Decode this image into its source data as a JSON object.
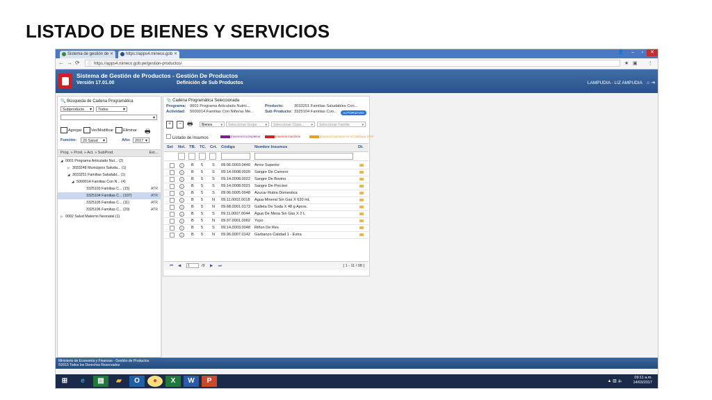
{
  "slide_title": "LISTADO DE BIENES Y SERVICIOS",
  "browser": {
    "tabs": [
      "Sistema de gestión de",
      "https://apps4.mineco.gob"
    ],
    "url": "https://apps4.mineco.gob.pe/gestion-productos/"
  },
  "app": {
    "system_name": "Sistema de Gestión de Productos - Gestión De Productos",
    "version": "Versión 17.01.00",
    "subtitle": "Definición de Sub Productos",
    "user": "LAMPUDIA - LIZ AMPUDIA"
  },
  "left": {
    "search_title": "Búsqueda de Cadena Programática",
    "select1": "Subproducto",
    "select2": "Todos",
    "btn_add": "Agregar",
    "btn_edit": "Ver/Modificar",
    "btn_delete": "Eliminar",
    "funcion_label": "Función:",
    "funcion_value": "20 Salud",
    "anio_label": "Año:",
    "anio_value": "2017",
    "tree_header": "Prog. » Prod. » Act. » SubProd.",
    "tree_header_est": "Est...",
    "tree": [
      {
        "text": "0001 Programa Articulado Nut... (2)",
        "tag": "",
        "toggle": "◢"
      },
      {
        "text": "3033248 Municipios Saluda... (1)",
        "tag": "",
        "toggle": "▷"
      },
      {
        "text": "3033251 Familias Saludabl... (1)",
        "tag": "",
        "toggle": "◢"
      },
      {
        "text": "5000014 Familias Con N... (4)",
        "tag": "",
        "toggle": "◢"
      },
      {
        "text": "3325103 Familias C... (15)",
        "tag": "ATR",
        "toggle": ""
      },
      {
        "text": "3325104 Familias C... (107)",
        "tag": "ATR",
        "toggle": ""
      },
      {
        "text": "3325105 Familias C... (11)",
        "tag": "ATR",
        "toggle": ""
      },
      {
        "text": "3325106 Familias C... (20)",
        "tag": "ATR",
        "toggle": ""
      },
      {
        "text": "0002 Salud Materno Neonatal (1)",
        "tag": "",
        "toggle": "▷"
      }
    ]
  },
  "right": {
    "cadena_title": "Cadena Programática Seleccionada",
    "programa_label": "Programa:",
    "programa_value": "0001 Programa Articulado Nutric...",
    "actividad_label": "Actividad:",
    "actividad_value": "5000014 Familias Con Niño/as Me...",
    "producto_label": "Producto:",
    "producto_value": "3033251 Familias Saludables Con...",
    "subproducto_label": "Sub Producto:",
    "subproducto_value": "3325104 Familias Con...",
    "status_badge": "AUTORIZADO",
    "filter_bienes": "Bienes",
    "filter_grupo": "Seleccionar Grupo",
    "filter_clase": "Seleccionar Clase...",
    "filter_familia": "Seleccionar Familia",
    "list_title": "Listado de Insumos",
    "legend": [
      {
        "label": "Insumos incompletos",
        "color": "#7a1f8a"
      },
      {
        "label": "Insumos Inactivos",
        "color": "#d42020"
      },
      {
        "label": "Insumos Inactivos en el Catálogo SIAF",
        "color": "#e8a020"
      }
    ],
    "columns": [
      "Sel",
      "Nvl.",
      "TB.",
      "TC.",
      "Crt.",
      "Código",
      "Nombre Insumos",
      "Dt."
    ],
    "rows": [
      {
        "tb": "B",
        "tc": "5",
        "crt": "S",
        "codigo": "09.06.0003.0440",
        "nombre": "Arroz Superior"
      },
      {
        "tb": "B",
        "tc": "5",
        "crt": "S",
        "codigo": "09.14.0008.0020",
        "nombre": "Sangre De Carnero"
      },
      {
        "tb": "B",
        "tc": "5",
        "crt": "S",
        "codigo": "09.14.0008.0022",
        "nombre": "Sangre De Bovino"
      },
      {
        "tb": "B",
        "tc": "5",
        "crt": "S",
        "codigo": "09.14.0008.0021",
        "nombre": "Sangre De Porcino"
      },
      {
        "tb": "B",
        "tc": "5",
        "crt": "S",
        "codigo": "09.06.0005.0048",
        "nombre": "Azucar Rubia Domestica"
      },
      {
        "tb": "B",
        "tc": "5",
        "crt": "N",
        "codigo": "09.11.0002.0018",
        "nombre": "Agua Mineral Sin Gas X 620 mL"
      },
      {
        "tb": "B",
        "tc": "5",
        "crt": "N",
        "codigo": "09.68.0001.0173",
        "nombre": "Galleta De Soda X 48 g Aprox."
      },
      {
        "tb": "B",
        "tc": "5",
        "crt": "S",
        "codigo": "09.11.0007.0044",
        "nombre": "Agua De Mesa Sin Gas X 2 L"
      },
      {
        "tb": "B",
        "tc": "5",
        "crt": "N",
        "codigo": "09.97.0001.0002",
        "nombre": "Yuyo"
      },
      {
        "tb": "B",
        "tc": "5",
        "crt": "S",
        "codigo": "09.14.0003.0048",
        "nombre": "Riñon De Res"
      },
      {
        "tb": "B",
        "tc": "5",
        "crt": "N",
        "codigo": "09.96.0007.0142",
        "nombre": "Garbanzo Calidad 1 - Extra"
      }
    ],
    "pager_page": "1",
    "pager_total": "/9",
    "pager_range": "[ 1 - 11 / 98 ]"
  },
  "footer": {
    "line1": "Ministerio de Economía y Finanzas - Gestión de Productos",
    "line2": "©2015 Todos los Derechos Reservados"
  },
  "taskbar": {
    "time": "09:11 a.m.",
    "date": "14/03/2017"
  }
}
